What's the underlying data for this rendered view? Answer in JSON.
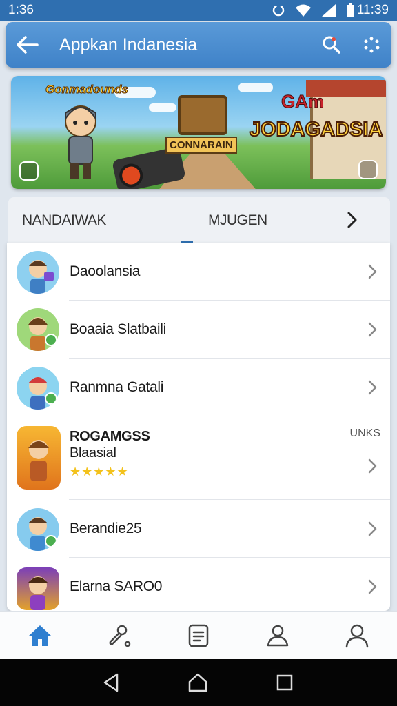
{
  "status_bar": {
    "time_left": "1:36",
    "time_right": "11:39"
  },
  "app_bar": {
    "title": "Appkan Indanesia"
  },
  "banner": {
    "logo_left": "Gonmadounds",
    "crate_label": "CONNARAIN",
    "logo_right_top": "GAm",
    "logo_right": "JODAGADSIA"
  },
  "tabs": {
    "items": [
      {
        "label": "NANDAIWAK"
      },
      {
        "label": "MJUGEN"
      }
    ]
  },
  "list": {
    "items": [
      {
        "label": "Daoolansia"
      },
      {
        "label": "Boaaia Slatbaili"
      },
      {
        "label": "Ranmna Gatali"
      },
      {
        "title": "ROGAMGSS",
        "subtitle": "Blaasial",
        "tag": "UNKS",
        "rating": "★★★★★",
        "stars": 5
      },
      {
        "label": "Berandie25"
      },
      {
        "label": "Elarna SARO0"
      }
    ]
  },
  "colors": {
    "primary": "#2f6fb0",
    "app_bar": "#4a8cd0",
    "star": "#f3c21c",
    "home_active": "#2f7fd0"
  },
  "bottom_nav": {
    "icons": [
      "home-icon",
      "tools-icon",
      "document-icon",
      "users-icon",
      "profile-icon"
    ]
  }
}
